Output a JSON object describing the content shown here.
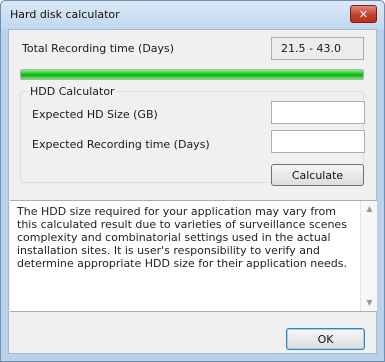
{
  "window": {
    "title": "Hard disk calculator",
    "close_glyph": "✕"
  },
  "total": {
    "label": "Total Recording time (Days)",
    "value": "21.5 - 43.0"
  },
  "progress": {
    "fill_fraction": 1.0,
    "color": "#1fc21f"
  },
  "hdd_calculator": {
    "legend": "HDD Calculator",
    "hd_size_label": "Expected HD Size (GB)",
    "hd_size_value": "",
    "recording_days_label": "Expected Recording time (Days)",
    "recording_days_value": "",
    "calculate_button": "Calculate"
  },
  "note": {
    "text": "The HDD size required for your application may vary from this calculated result due to varieties of surveillance scenes complexity and combinatorial settings used in the actual installation sites. It is user's responsibility to verify and determine appropriate HDD size for their application needs."
  },
  "scroll": {
    "up_icon": "▲",
    "down_icon": "▼"
  },
  "ok_button": "OK"
}
